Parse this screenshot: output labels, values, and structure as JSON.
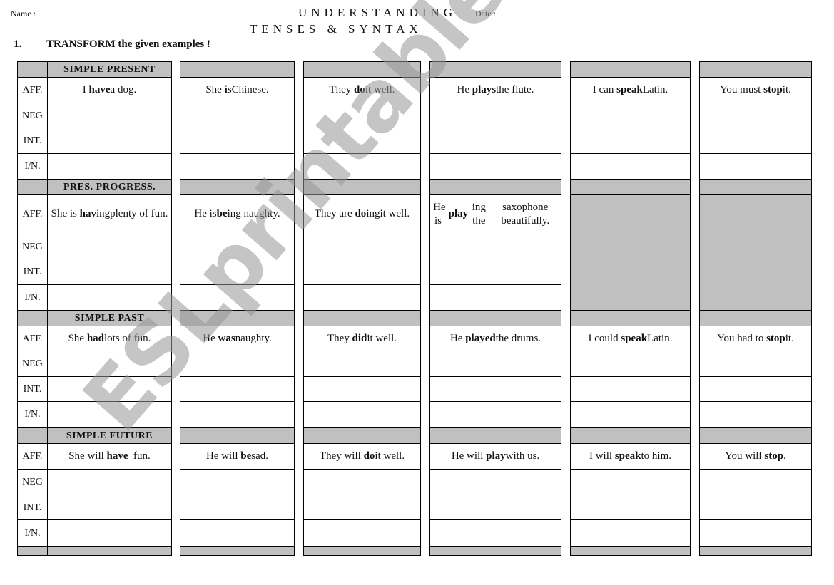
{
  "header": {
    "name_label": "Name :",
    "title_line1": "UNDERSTANDING",
    "date_label": "Date :",
    "title_line2": "TENSES & SYNTAX",
    "instruction_number": "1.",
    "instruction_text": "TRANSFORM the given examples !"
  },
  "row_labels": [
    "AFF.",
    "NEG",
    "INT.",
    "I/N."
  ],
  "sections": [
    {
      "title": "SIMPLE PRESENT",
      "examples": [
        {
          "parts": [
            [
              "I ",
              false
            ],
            [
              "have",
              true
            ],
            [
              " a dog.",
              false
            ]
          ]
        },
        {
          "parts": [
            [
              "She ",
              false
            ],
            [
              "is",
              true
            ],
            [
              " Chinese.",
              false
            ]
          ]
        },
        {
          "parts": [
            [
              "They ",
              false
            ],
            [
              "do",
              true
            ],
            [
              " it well.",
              false
            ]
          ]
        },
        {
          "parts": [
            [
              "He ",
              false
            ],
            [
              "plays",
              true
            ],
            [
              " the flute.",
              false
            ]
          ]
        },
        {
          "parts": [
            [
              "I can ",
              false
            ],
            [
              "speak",
              true
            ],
            [
              " Latin.",
              false
            ]
          ]
        },
        {
          "parts": [
            [
              "You must ",
              false
            ],
            [
              "stop",
              true
            ],
            [
              " it.",
              false
            ]
          ]
        }
      ]
    },
    {
      "title": "PRES. PROGRESS.",
      "examples": [
        {
          "parts": [
            [
              "She is ",
              false
            ],
            [
              "hav",
              true
            ],
            [
              "ing\nplenty of fun.",
              false
            ]
          ]
        },
        {
          "parts": [
            [
              "He is\n",
              false
            ],
            [
              "be",
              true
            ],
            [
              "ing naughty.",
              false
            ]
          ]
        },
        {
          "parts": [
            [
              "They are ",
              false
            ],
            [
              "do",
              true
            ],
            [
              "ing\nit well.",
              false
            ]
          ]
        },
        {
          "parts": [
            [
              "He is ",
              false
            ],
            [
              "play",
              true
            ],
            [
              "ing the\nsaxophone beautifully.",
              false
            ]
          ]
        },
        {
          "greyed": true
        },
        {
          "greyed": true
        }
      ]
    },
    {
      "title": "SIMPLE PAST",
      "examples": [
        {
          "parts": [
            [
              "She ",
              false
            ],
            [
              "had",
              true
            ],
            [
              " lots of fun.",
              false
            ]
          ]
        },
        {
          "parts": [
            [
              "He ",
              false
            ],
            [
              "was",
              true
            ],
            [
              " naughty.",
              false
            ]
          ]
        },
        {
          "parts": [
            [
              "They ",
              false
            ],
            [
              "did",
              true
            ],
            [
              " it well.",
              false
            ]
          ]
        },
        {
          "parts": [
            [
              "He ",
              false
            ],
            [
              "played",
              true
            ],
            [
              " the drums.",
              false
            ]
          ]
        },
        {
          "parts": [
            [
              "I could ",
              false
            ],
            [
              "speak",
              true
            ],
            [
              " Latin.",
              false
            ]
          ]
        },
        {
          "parts": [
            [
              "You had to ",
              false
            ],
            [
              "stop",
              true
            ],
            [
              " it.",
              false
            ]
          ]
        }
      ]
    },
    {
      "title": "SIMPLE FUTURE",
      "examples": [
        {
          "parts": [
            [
              "She will ",
              false
            ],
            [
              "have",
              true
            ],
            [
              "  fun.",
              false
            ]
          ]
        },
        {
          "parts": [
            [
              "He will ",
              false
            ],
            [
              "be",
              true
            ],
            [
              " sad.",
              false
            ]
          ]
        },
        {
          "parts": [
            [
              "They will ",
              false
            ],
            [
              "do",
              true
            ],
            [
              " it well.",
              false
            ]
          ]
        },
        {
          "parts": [
            [
              "He will ",
              false
            ],
            [
              "play",
              true
            ],
            [
              " with us.",
              false
            ]
          ]
        },
        {
          "parts": [
            [
              "I will ",
              false
            ],
            [
              "speak",
              true
            ],
            [
              " to him.",
              false
            ]
          ]
        },
        {
          "parts": [
            [
              "You will ",
              false
            ],
            [
              "stop",
              true
            ],
            [
              ".",
              false
            ]
          ]
        }
      ]
    }
  ],
  "watermark": "ESLprintables.com"
}
